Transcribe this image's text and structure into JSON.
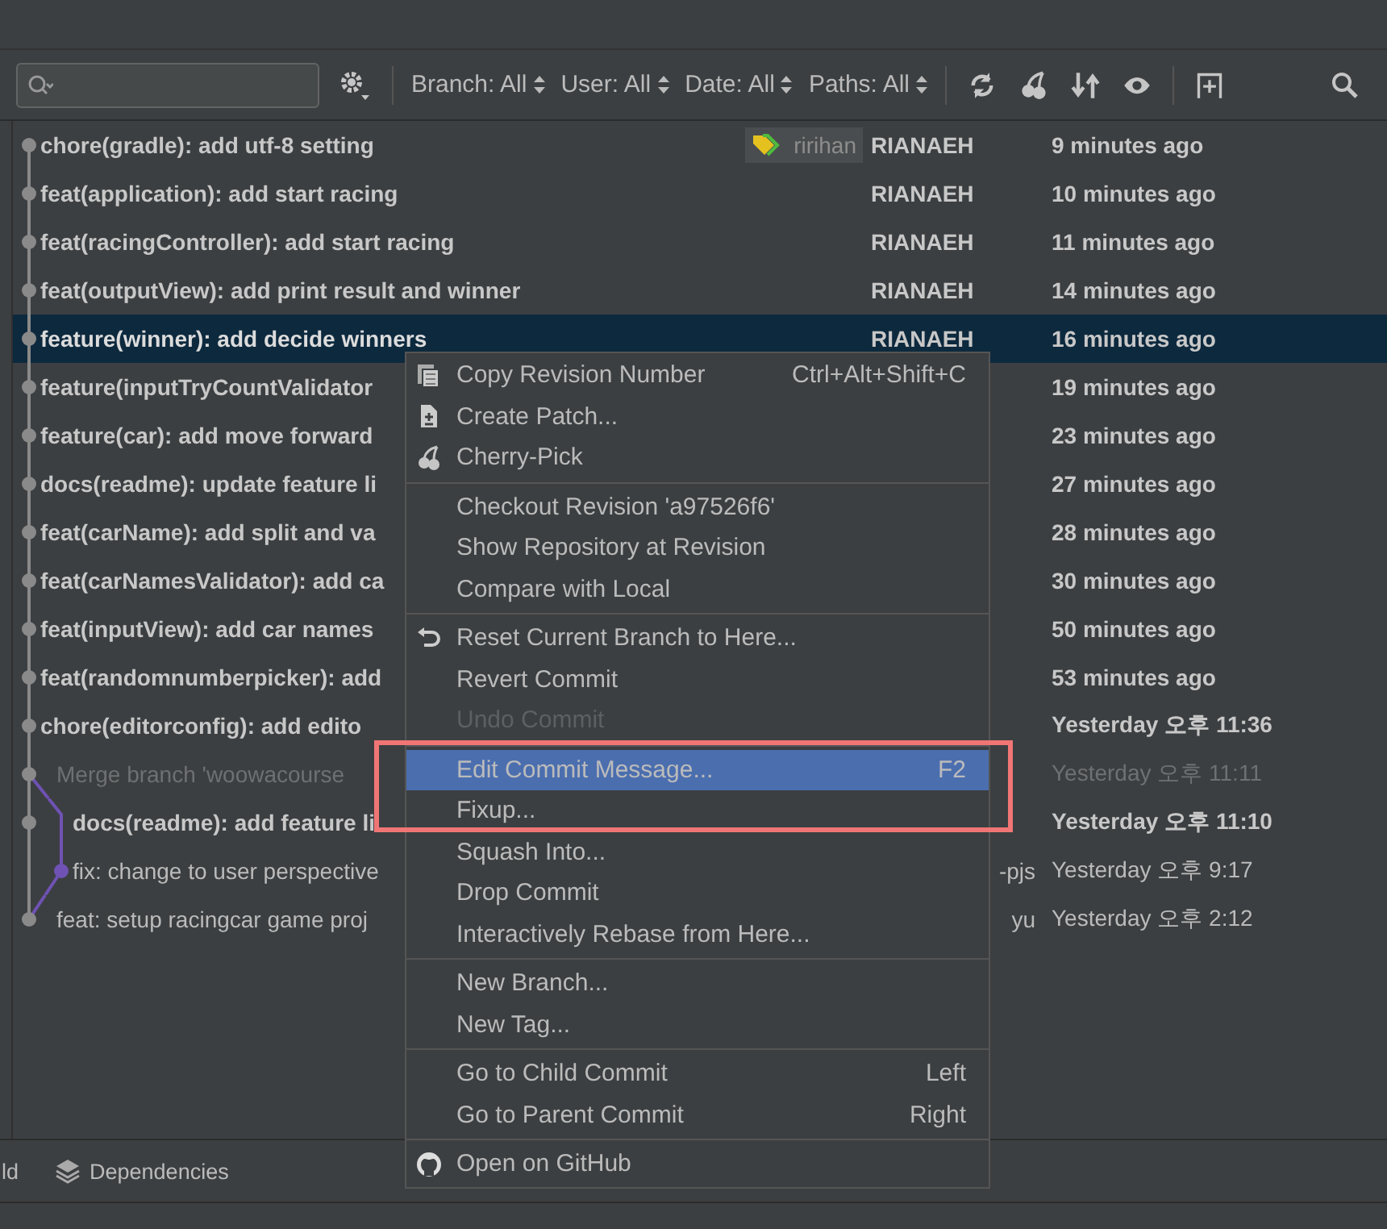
{
  "toolbar": {
    "filters": [
      {
        "label": "Branch: All"
      },
      {
        "label": "User: All"
      },
      {
        "label": "Date: All"
      },
      {
        "label": "Paths: All"
      }
    ]
  },
  "commits": [
    {
      "message": "chore(gradle): add utf-8 setting",
      "tag": "ririhan",
      "author": "RIANAEH",
      "date": "9 minutes ago",
      "kind": "commit",
      "selected": false
    },
    {
      "message": "feat(application): add start racing",
      "author": "RIANAEH",
      "date": "10 minutes ago",
      "kind": "commit",
      "selected": false
    },
    {
      "message": "feat(racingController): add start racing",
      "author": "RIANAEH",
      "date": "11 minutes ago",
      "kind": "commit",
      "selected": false
    },
    {
      "message": "feat(outputView): add print result and winner",
      "author": "RIANAEH",
      "date": "14 minutes ago",
      "kind": "commit",
      "selected": false
    },
    {
      "message": "feature(winner): add decide winners",
      "author": "RIANAEH",
      "date": "16 minutes ago",
      "kind": "commit",
      "selected": true
    },
    {
      "message": "feature(inputTryCountValidator",
      "date": "19 minutes ago",
      "kind": "commit",
      "selected": false
    },
    {
      "message": "feature(car): add move forward",
      "date": "23 minutes ago",
      "kind": "commit",
      "selected": false
    },
    {
      "message": "docs(readme): update feature li",
      "date": "27 minutes ago",
      "kind": "commit",
      "selected": false
    },
    {
      "message": "feat(carName): add split and va",
      "date": "28 minutes ago",
      "kind": "commit",
      "selected": false
    },
    {
      "message": "feat(carNamesValidator): add ca",
      "date": "30 minutes ago",
      "kind": "commit",
      "selected": false
    },
    {
      "message": "feat(inputView): add car names",
      "date": "50 minutes ago",
      "kind": "commit",
      "selected": false
    },
    {
      "message": "feat(randomnumberpicker): add",
      "date": "53 minutes ago",
      "kind": "commit",
      "selected": false
    },
    {
      "message": "chore(editorconfig): add edito",
      "date": "Yesterday 오후 11:36",
      "kind": "commit",
      "selected": false
    },
    {
      "message": "Merge branch 'woowacourse",
      "date": "Yesterday 오후 11:11",
      "kind": "merge",
      "selected": false
    },
    {
      "message": "docs(readme): add feature li",
      "date": "Yesterday 오후 11:10",
      "kind": "parallel",
      "selected": false
    },
    {
      "message": "fix: change to user perspective",
      "author": "-pjs",
      "date": "Yesterday 오후 9:17",
      "kind": "side",
      "selected": false
    },
    {
      "message": "feat: setup racingcar game proj",
      "author": "yu",
      "date": "Yesterday 오후 2:12",
      "kind": "join",
      "selected": false
    }
  ],
  "context_menu": {
    "groups": [
      [
        {
          "label": "Copy Revision Number",
          "shortcut": "Ctrl+Alt+Shift+C",
          "kind": "copy",
          "disabled": false,
          "selected": false
        },
        {
          "label": "Create Patch...",
          "kind": "patch",
          "disabled": false,
          "selected": false
        },
        {
          "label": "Cherry-Pick",
          "kind": "cherry",
          "disabled": false,
          "selected": false
        }
      ],
      [
        {
          "label": "Checkout Revision 'a97526f6'",
          "kind": "plain",
          "disabled": false,
          "selected": false
        },
        {
          "label": "Show Repository at Revision",
          "kind": "plain",
          "disabled": false,
          "selected": false
        },
        {
          "label": "Compare with Local",
          "kind": "plain",
          "disabled": false,
          "selected": false
        }
      ],
      [
        {
          "label": "Reset Current Branch to Here...",
          "kind": "undo",
          "disabled": false,
          "selected": false
        },
        {
          "label": "Revert Commit",
          "kind": "plain",
          "disabled": false,
          "selected": false
        },
        {
          "label": "Undo Commit",
          "kind": "plain",
          "disabled": true,
          "selected": false
        }
      ],
      [
        {
          "label": "Edit Commit Message...",
          "shortcut": "F2",
          "kind": "plain",
          "disabled": false,
          "selected": true
        },
        {
          "label": "Fixup...",
          "kind": "plain",
          "disabled": false,
          "selected": false
        },
        {
          "label": "Squash Into...",
          "kind": "plain",
          "disabled": false,
          "selected": false
        },
        {
          "label": "Drop Commit",
          "kind": "plain",
          "disabled": false,
          "selected": false
        },
        {
          "label": "Interactively Rebase from Here...",
          "kind": "plain",
          "disabled": false,
          "selected": false
        }
      ],
      [
        {
          "label": "New Branch...",
          "kind": "plain",
          "disabled": false,
          "selected": false
        },
        {
          "label": "New Tag...",
          "kind": "plain",
          "disabled": false,
          "selected": false
        }
      ],
      [
        {
          "label": "Go to Child Commit",
          "shortcut": "Left",
          "kind": "plain",
          "disabled": false,
          "selected": false
        },
        {
          "label": "Go to Parent Commit",
          "shortcut": "Right",
          "kind": "plain",
          "disabled": false,
          "selected": false
        }
      ],
      [
        {
          "label": "Open on GitHub",
          "kind": "github",
          "disabled": false,
          "selected": false
        }
      ]
    ]
  },
  "bottom_tabs": [
    {
      "label": "ld",
      "kind": "plain"
    },
    {
      "label": "Dependencies",
      "kind": "layers"
    }
  ]
}
